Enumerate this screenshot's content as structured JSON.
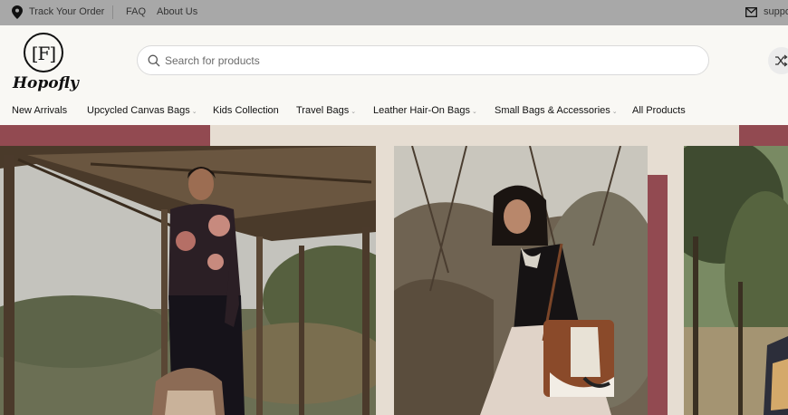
{
  "topbar": {
    "track_order": "Track Your Order",
    "faq": "FAQ",
    "about": "About Us",
    "support": "suppo"
  },
  "brand": {
    "monogram": "[F]",
    "wordmark": "Hopofly"
  },
  "search": {
    "placeholder": "Search for products"
  },
  "nav": {
    "items": [
      {
        "label": "New Arrivals",
        "has_dropdown": false
      },
      {
        "label": "Upcycled Canvas Bags",
        "has_dropdown": true
      },
      {
        "label": "Kids Collection",
        "has_dropdown": false
      },
      {
        "label": "Travel Bags",
        "has_dropdown": true
      },
      {
        "label": "Leather Hair-On Bags",
        "has_dropdown": true
      },
      {
        "label": "Small Bags & Accessories",
        "has_dropdown": true
      },
      {
        "label": "All Products",
        "has_dropdown": false
      }
    ],
    "caret": "⌄"
  },
  "colors": {
    "topbar_bg": "#a8a8a8",
    "header_bg": "#f9f8f4",
    "hero_bg": "#e6ddd2",
    "accent_maroon": "#924a51"
  }
}
